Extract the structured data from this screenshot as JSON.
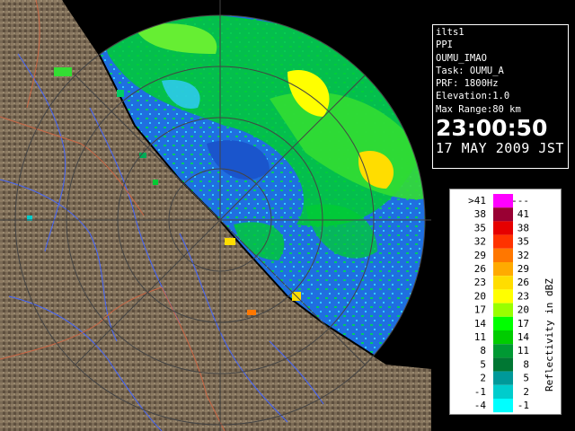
{
  "radar": {
    "title": "ilts1",
    "product": "PPI",
    "station": "OUMU_IMAO",
    "task": "Task: OUMU_A",
    "prf": "PRF: 1800Hz",
    "elevation": "Elevation:1.0",
    "max_range": "Max Range:80 km",
    "time": "23:00:50",
    "date": "17 MAY 2009 JST"
  },
  "legend": {
    "title": "Reflectivity in dBZ",
    "bins": [
      {
        "low": ">41",
        "high": "---",
        "color": "#ff00ff"
      },
      {
        "low": "38",
        "high": "41",
        "color": "#990033"
      },
      {
        "low": "35",
        "high": "38",
        "color": "#e60000"
      },
      {
        "low": "32",
        "high": "35",
        "color": "#ff3300"
      },
      {
        "low": "29",
        "high": "32",
        "color": "#ff7700"
      },
      {
        "low": "26",
        "high": "29",
        "color": "#ffaa00"
      },
      {
        "low": "23",
        "high": "26",
        "color": "#ffdd00"
      },
      {
        "low": "20",
        "high": "23",
        "color": "#ffff00"
      },
      {
        "low": "17",
        "high": "20",
        "color": "#99ff00"
      },
      {
        "low": "14",
        "high": "17",
        "color": "#00ff00"
      },
      {
        "low": "11",
        "high": "14",
        "color": "#00cc00"
      },
      {
        "low": "8",
        "high": "11",
        "color": "#009933"
      },
      {
        "low": "5",
        "high": "8",
        "color": "#007733"
      },
      {
        "low": "2",
        "high": "5",
        "color": "#009999"
      },
      {
        "low": "-1",
        "high": "2",
        "color": "#00cccc"
      },
      {
        "low": "-4",
        "high": "-1",
        "color": "#00ffff"
      }
    ]
  },
  "colors": {
    "land": "#7a6a55",
    "sea_echo": "#2277dd",
    "clutter_blue": "#1144ff",
    "rivers": "#4466ff",
    "borders": "#cc6644"
  }
}
